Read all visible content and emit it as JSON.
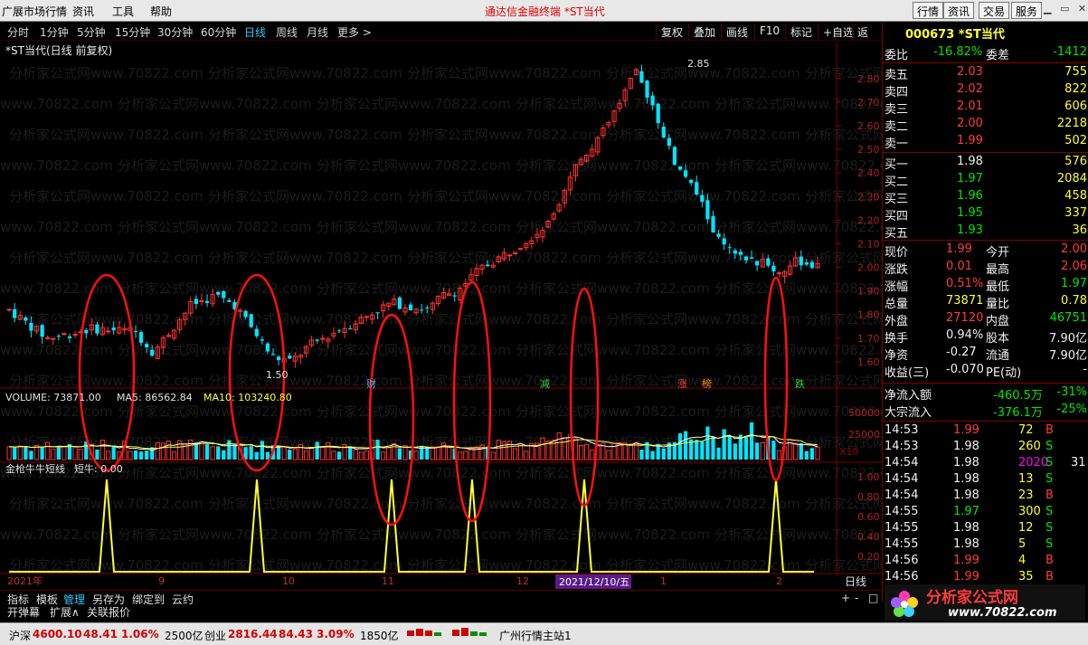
{
  "menubar": {
    "items": [
      "广展市场行情",
      "资讯",
      "工具",
      "帮助"
    ],
    "app_title": "通达信金融终端  *ST当代",
    "top_buttons": [
      "行情",
      "资讯",
      "交易",
      "服务"
    ]
  },
  "timeframes": {
    "items": [
      "分时",
      "1分钟",
      "5分钟",
      "15分钟",
      "30分钟",
      "60分钟",
      "日线",
      "周线",
      "月线",
      "更多 >"
    ],
    "active": "日线",
    "right_buttons": [
      "复权",
      "叠加",
      "画线",
      "F10",
      "标记",
      "+自选",
      "返回"
    ]
  },
  "chart": {
    "title": "*ST当代(日线 前复权)",
    "price_axis": [
      "2.80",
      "2.70",
      "2.60",
      "2.50",
      "2.40",
      "2.30",
      "2.20",
      "2.10",
      "2.00",
      "1.90",
      "1.80",
      "1.70",
      "1.60"
    ],
    "high_label": "2.85",
    "low_label": "1.50",
    "badges": [
      {
        "text": "财",
        "color": "#4db3ff"
      },
      {
        "text": "减",
        "color": "#32d232"
      },
      {
        "text": "涨",
        "color": "#ff4040"
      },
      {
        "text": "榜",
        "color": "#ff8c1a"
      },
      {
        "text": "跌",
        "color": "#32d232"
      }
    ],
    "volume_label": "VOLUME: 73871.00",
    "ma5_label": "MA5: 86562.84",
    "ma10_label": "MA10: 103240.80",
    "volume_axis": [
      "50000",
      "25000"
    ],
    "volume_unit": "X10",
    "indicator_label": "金枪牛牛短线",
    "indicator_value": "短牛: 0.00",
    "indicator_axis": [
      "1.00",
      "0.80",
      "0.60",
      "0.40",
      "0.20"
    ],
    "date_axis": [
      "2021年",
      "9",
      "10",
      "11",
      "12",
      "1",
      "2"
    ],
    "cursor_date": "2021/12/10/五",
    "period_label": "日线",
    "watermark": "分析家公式网www.70822.com"
  },
  "chart_data": {
    "type": "candlestick",
    "title": "*ST当代(日线 前复权)",
    "ylim": [
      1.5,
      2.88
    ],
    "high": 2.85,
    "low": 1.5,
    "indicator_spikes": 6,
    "volume_ylim": [
      0,
      60000
    ]
  },
  "quote": {
    "code_name": "000673 *ST当代",
    "weibi_label": "委比",
    "weibi": "-16.82%",
    "weicha_label": "委差",
    "weicha": "-1412",
    "sell": [
      {
        "label": "卖五",
        "price": "2.03",
        "vol": "755"
      },
      {
        "label": "卖四",
        "price": "2.02",
        "vol": "822"
      },
      {
        "label": "卖三",
        "price": "2.01",
        "vol": "606"
      },
      {
        "label": "卖二",
        "price": "2.00",
        "vol": "2218"
      },
      {
        "label": "卖一",
        "price": "1.99",
        "vol": "502"
      }
    ],
    "buy": [
      {
        "label": "买一",
        "price": "1.98",
        "vol": "576"
      },
      {
        "label": "买二",
        "price": "1.97",
        "vol": "2084"
      },
      {
        "label": "买三",
        "price": "1.96",
        "vol": "458"
      },
      {
        "label": "买四",
        "price": "1.95",
        "vol": "337"
      },
      {
        "label": "买五",
        "price": "1.93",
        "vol": "36"
      }
    ],
    "stats": [
      {
        "l1": "现价",
        "v1": "1.99",
        "c1": "red",
        "l2": "今开",
        "v2": "2.00",
        "c2": "red"
      },
      {
        "l1": "涨跌",
        "v1": "0.01",
        "c1": "red",
        "l2": "最高",
        "v2": "2.06",
        "c2": "red"
      },
      {
        "l1": "涨幅",
        "v1": "0.51%",
        "c1": "red",
        "l2": "最低",
        "v2": "1.97",
        "c2": "green"
      },
      {
        "l1": "总量",
        "v1": "73871",
        "c1": "yellow",
        "l2": "量比",
        "v2": "0.78",
        "c2": "yellow"
      },
      {
        "l1": "外盘",
        "v1": "27120",
        "c1": "red",
        "l2": "内盘",
        "v2": "46751",
        "c2": "green"
      },
      {
        "l1": "换手",
        "v1": "0.94%",
        "c1": "white",
        "l2": "股本",
        "v2": "7.90亿",
        "c2": "white"
      },
      {
        "l1": "净资",
        "v1": "-0.27",
        "c1": "white",
        "l2": "流通",
        "v2": "7.90亿",
        "c2": "white"
      },
      {
        "l1": "收益(三)",
        "v1": "-0.070",
        "c1": "white",
        "l2": "PE(动)",
        "v2": "-",
        "c2": "white"
      }
    ],
    "flow": [
      {
        "label": "净流入额",
        "v1": "-460.5万",
        "v2": "-31%"
      },
      {
        "label": "大宗流入",
        "v1": "-376.1万",
        "v2": "-25%"
      }
    ],
    "ticks": [
      {
        "t": "14:53",
        "p": "1.99",
        "pc": "red",
        "v": "72",
        "vc": "yellow",
        "bs": "B"
      },
      {
        "t": "14:53",
        "p": "1.98",
        "pc": "white",
        "v": "260",
        "vc": "yellow",
        "bs": "S"
      },
      {
        "t": "14:54",
        "p": "1.98",
        "pc": "white",
        "v": "2020",
        "vc": "pink",
        "bs": "S"
      },
      {
        "t": "14:54",
        "p": "1.98",
        "pc": "white",
        "v": "13",
        "vc": "yellow",
        "bs": "S"
      },
      {
        "t": "14:54",
        "p": "1.98",
        "pc": "white",
        "v": "23",
        "vc": "yellow",
        "bs": "B"
      },
      {
        "t": "14:55",
        "p": "1.97",
        "pc": "green",
        "v": "300",
        "vc": "yellow",
        "bs": "S"
      },
      {
        "t": "14:55",
        "p": "1.98",
        "pc": "white",
        "v": "12",
        "vc": "yellow",
        "bs": "S"
      },
      {
        "t": "14:55",
        "p": "1.98",
        "pc": "white",
        "v": "5",
        "vc": "yellow",
        "bs": "S"
      },
      {
        "t": "14:56",
        "p": "1.99",
        "pc": "red",
        "v": "4",
        "vc": "yellow",
        "bs": "B"
      },
      {
        "t": "14:56",
        "p": "1.99",
        "pc": "red",
        "v": "35",
        "vc": "yellow",
        "bs": "B"
      }
    ],
    "tick_extra": "31"
  },
  "bottom_tabs": [
    "指标",
    "模板",
    "管理",
    "另存为",
    "绑定到",
    "云约"
  ],
  "bottom_tabs2": [
    "开弹幕",
    "扩展∧",
    "关联报价"
  ],
  "status": {
    "sh_label": "沪深",
    "sh_val": "4600.10",
    "sh_chg": "48.41",
    "sh_pct": "1.06%",
    "sh_amt": "2500亿",
    "cy_label": "创业",
    "cy_val": "2816.44",
    "cy_chg": "84.43",
    "cy_pct": "3.09%",
    "cy_amt": "1850亿",
    "server": "广州行情主站1"
  },
  "logo": {
    "text": "分析家公式网",
    "url": "www.70822.com"
  }
}
